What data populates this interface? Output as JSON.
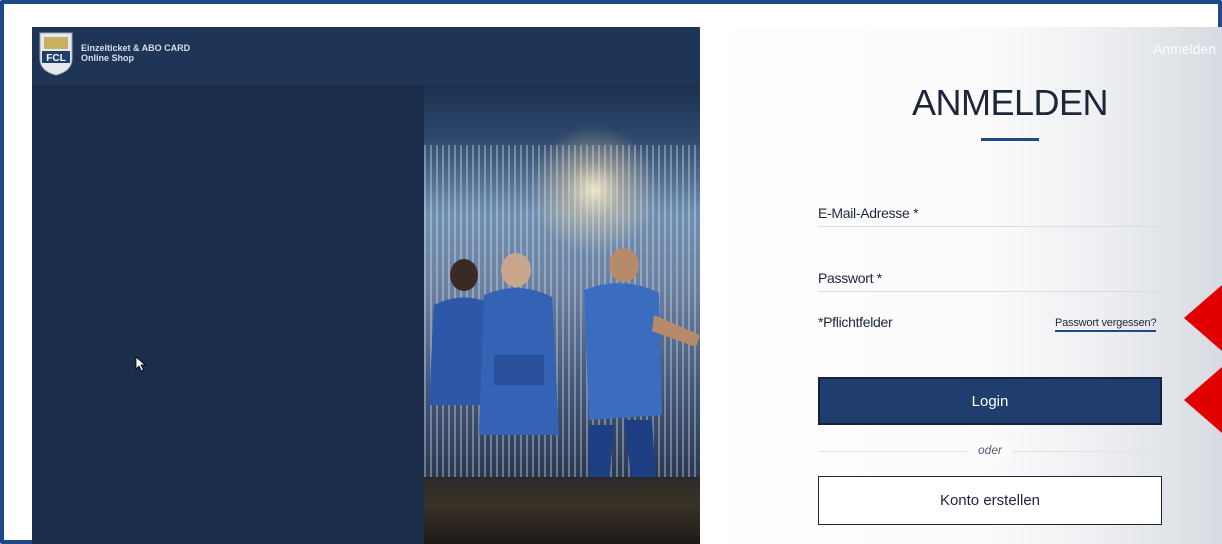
{
  "brand": {
    "line1": "Einzelticket & ABO CARD",
    "line2": "Online Shop",
    "logo_text": "FCL"
  },
  "top_right_label": "Anmelden",
  "login": {
    "heading": "ANMELDEN",
    "email_label": "E-Mail-Adresse *",
    "password_label": "Passwort *",
    "required_note": "*Pflichtfelder",
    "forgot_link": "Passwort vergessen?",
    "login_button": "Login",
    "divider_text": "oder",
    "create_account_button": "Konto erstellen"
  },
  "colors": {
    "frame_border": "#1f4a86",
    "navy_panel": "#1b2d4b",
    "primary_button": "#1f3e6e",
    "annotation_arrow": "#e00000"
  },
  "icons": [
    "fcl-logo-icon",
    "mouse-cursor-icon",
    "red-arrow-icon"
  ]
}
